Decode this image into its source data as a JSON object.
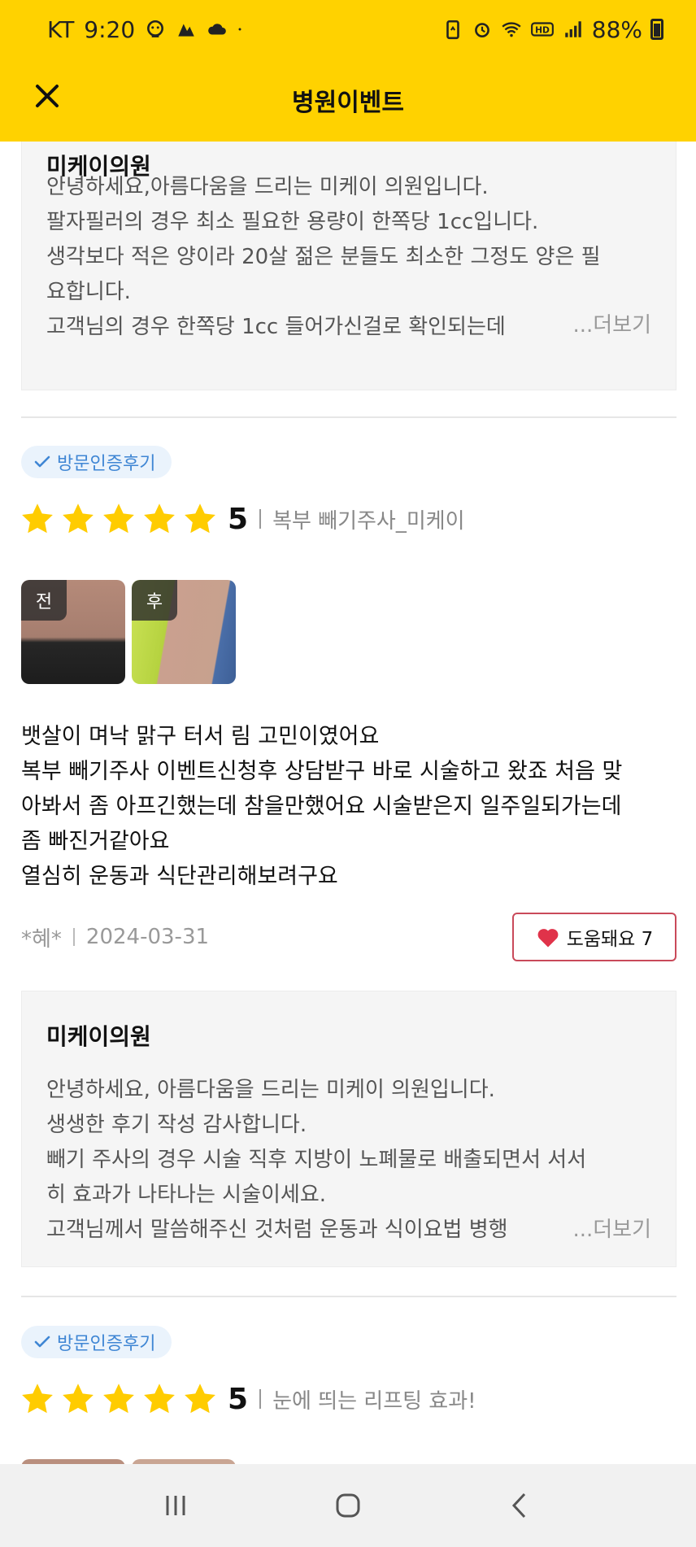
{
  "status_bar": {
    "carrier": "KT",
    "time": "9:20",
    "battery_percent": "88%"
  },
  "app_bar": {
    "title": "병원이벤트"
  },
  "reviews": [
    {
      "reply": {
        "name": "미케이의원",
        "lines": [
          "안녕하세요,아름다움을 드리는 미케이 의원입니다.",
          "팔자필러의 경우 최소 필요한 용량이 한쪽당 1cc입니다.",
          "생각보다 적은 양이라 20살 젊은 분들도 최소한 그정도 양은 필",
          "요합니다.",
          "고객님의 경우 한쪽당 1cc 들어가신걸로 확인되는데"
        ],
        "more_label": "...더보기"
      }
    },
    {
      "badge": "방문인증후기",
      "score": "5",
      "rating": 5,
      "title": "복부 빼기주사_미케이",
      "photo_tags": [
        "전",
        "후"
      ],
      "body_lines": [
        "뱃살이 며낙 맑구 터서 림 고민이였어요",
        "복부 빼기주사 이벤트신청후 상담받구 바로 시술하고 왔죠 처음 맞",
        "아봐서 좀 아프긴했는데 참을만했어요 시술받은지 일주일되가는데",
        "좀 빠진거같아요",
        "열심히 운동과 식단관리해보려구요"
      ],
      "author": "*혜*",
      "date": "2024-03-31",
      "helpful_label": "도움돼요 7",
      "reply": {
        "name": "미케이의원",
        "lines": [
          "안녕하세요, 아름다움을 드리는 미케이 의원입니다.",
          "생생한 후기 작성 감사합니다.",
          "빼기 주사의 경우 시술 직후 지방이 노폐물로 배출되면서 서서",
          "히 효과가 나타나는 시술이세요.",
          "고객님께서 말씀해주신 것처럼 운동과 식이요법 병행"
        ],
        "more_label": "...더보기"
      }
    },
    {
      "badge": "방문인증후기",
      "score": "5",
      "rating": 5,
      "title": "눈에 띄는 리프팅 효과!"
    }
  ],
  "colors": {
    "brand_yellow": "#FFD200",
    "star": "#FFCC00",
    "badge_blue": "#3f86d4",
    "heart_red": "#e0334a"
  },
  "icons": {
    "close": "close-icon",
    "check": "check-icon",
    "star": "star-icon",
    "heart": "heart-icon"
  }
}
